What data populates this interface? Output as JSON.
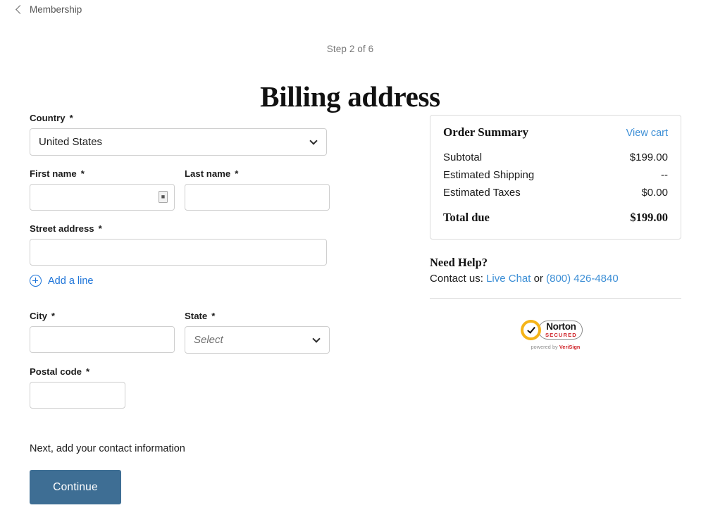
{
  "breadcrumb": {
    "icon": "chevron-left-icon",
    "label": "Membership"
  },
  "header": {
    "step": "Step 2 of 6",
    "title": "Billing address"
  },
  "form": {
    "country": {
      "label": "Country",
      "required": "*",
      "value": "United States"
    },
    "first_name": {
      "label": "First name",
      "required": "*",
      "value": "",
      "icon": "autofill-contact-card-icon"
    },
    "last_name": {
      "label": "Last name",
      "required": "*",
      "value": ""
    },
    "street_address": {
      "label": "Street address",
      "required": "*",
      "value": ""
    },
    "add_line": {
      "label": "Add a line",
      "icon": "plus-circle-icon"
    },
    "city": {
      "label": "City",
      "required": "*",
      "value": ""
    },
    "state": {
      "label": "State",
      "required": "*",
      "placeholder": "Select"
    },
    "postal_code": {
      "label": "Postal code",
      "required": "*",
      "value": ""
    },
    "next_note": "Next, add your contact information",
    "continue_label": "Continue"
  },
  "order_summary": {
    "title": "Order Summary",
    "view_cart": "View cart",
    "rows": [
      {
        "label": "Subtotal",
        "value": "$199.00"
      },
      {
        "label": "Estimated Shipping",
        "value": "--"
      },
      {
        "label": "Estimated Taxes",
        "value": "$0.00"
      }
    ],
    "total": {
      "label": "Total due",
      "value": "$199.00"
    }
  },
  "help": {
    "title": "Need Help?",
    "prefix": "Contact us:",
    "live_chat": "Live Chat",
    "conjunction": "or",
    "phone": "(800) 426-4840"
  },
  "badge": {
    "name": "Norton",
    "secured": "SECURED",
    "powered_prefix": "powered by",
    "powered_brand": "VeriSign"
  },
  "colors": {
    "link": "#1a72d8",
    "summary_link": "#3d8fd6",
    "button": "#3e6e94",
    "badge_yellow": "#f5b418",
    "badge_red": "#cf2026"
  }
}
